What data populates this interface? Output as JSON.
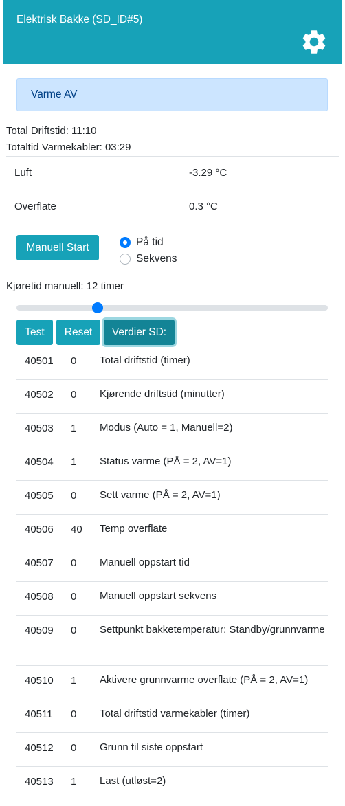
{
  "header": {
    "title": "Elektrisk Bakke (SD_ID#5)",
    "color": "#17a2b8",
    "settings_icon": "gear-icon"
  },
  "status": {
    "alert_text": "Varme AV"
  },
  "runtime": {
    "total_label": "Total Driftstid: 11:10",
    "cables_label": "Totaltid Varmekabler: 03:29"
  },
  "sensors": [
    {
      "label": "Luft",
      "value": "-3.29 °C"
    },
    {
      "label": "Overflate",
      "value": "0.3 °C"
    }
  ],
  "controls": {
    "manual_start_label": "Manuell Start",
    "mode_options": [
      {
        "label": "På tid",
        "checked": true
      },
      {
        "label": "Sekvens",
        "checked": false
      }
    ],
    "runtime_manual_label": "Kjøretid manuell: 12 timer",
    "slider_fraction": 0.26
  },
  "buttons": {
    "test_label": "Test",
    "reset_label": "Reset",
    "values_label": "Verdier SD:"
  },
  "sd_values": [
    {
      "addr": "40501",
      "val": "0",
      "desc": "Total driftstid (timer)"
    },
    {
      "addr": "40502",
      "val": "0",
      "desc": "Kjørende driftstid (minutter)"
    },
    {
      "addr": "40503",
      "val": "1",
      "desc": "Modus (Auto = 1, Manuell=2)"
    },
    {
      "addr": "40504",
      "val": "1",
      "desc": "Status varme (PÅ = 2, AV=1)"
    },
    {
      "addr": "40505",
      "val": "0",
      "desc": "Sett varme (PÅ = 2, AV=1)"
    },
    {
      "addr": "40506",
      "val": "40",
      "desc": "Temp overflate"
    },
    {
      "addr": "40507",
      "val": "0",
      "desc": "Manuell oppstart tid"
    },
    {
      "addr": "40508",
      "val": "0",
      "desc": "Manuell oppstart sekvens"
    },
    {
      "addr": "40509",
      "val": "0",
      "desc": "Settpunkt bakketemperatur: Standby/grunnvarme"
    },
    {
      "addr": "40510",
      "val": "1",
      "desc": "Aktivere grunnvarme overflate (PÅ = 2, AV=1)"
    },
    {
      "addr": "40511",
      "val": "0",
      "desc": "Total driftstid varmekabler (timer)"
    },
    {
      "addr": "40512",
      "val": "0",
      "desc": "Grunn til siste oppstart"
    },
    {
      "addr": "40513",
      "val": "1",
      "desc": "Last (utløst=2)"
    }
  ]
}
